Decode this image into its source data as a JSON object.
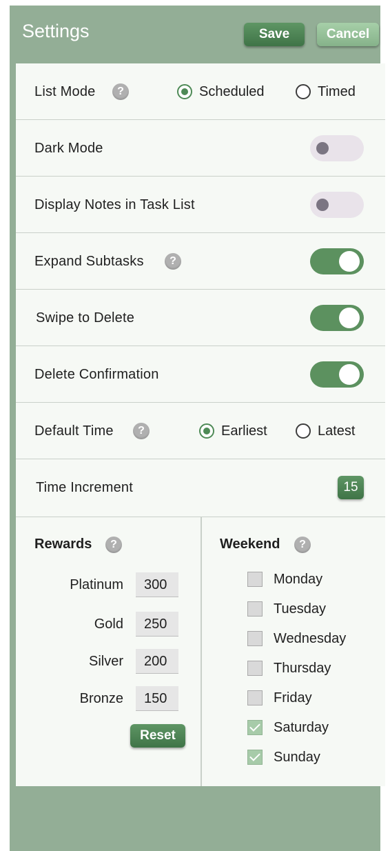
{
  "header": {
    "title": "Settings",
    "save_label": "Save",
    "cancel_label": "Cancel"
  },
  "list_mode": {
    "label": "List Mode",
    "options": [
      "Scheduled",
      "Timed"
    ],
    "selected": "Scheduled"
  },
  "dark_mode": {
    "label": "Dark Mode",
    "on": false
  },
  "display_notes": {
    "label": "Display Notes in Task List",
    "on": false
  },
  "expand_subtasks": {
    "label": "Expand Subtasks",
    "on": true
  },
  "swipe_delete": {
    "label": "Swipe to Delete",
    "on": true
  },
  "delete_confirmation": {
    "label": "Delete Confirmation",
    "on": true
  },
  "default_time": {
    "label": "Default Time",
    "options": [
      "Earliest",
      "Latest"
    ],
    "selected": "Earliest"
  },
  "time_increment": {
    "label": "Time Increment",
    "value": "15"
  },
  "rewards": {
    "title": "Rewards",
    "items": [
      {
        "label": "Platinum",
        "value": "300"
      },
      {
        "label": "Gold",
        "value": "250"
      },
      {
        "label": "Silver",
        "value": "200"
      },
      {
        "label": "Bronze",
        "value": "150"
      }
    ],
    "reset_label": "Reset"
  },
  "weekend": {
    "title": "Weekend",
    "days": [
      {
        "label": "Monday",
        "checked": false
      },
      {
        "label": "Tuesday",
        "checked": false
      },
      {
        "label": "Wednesday",
        "checked": false
      },
      {
        "label": "Thursday",
        "checked": false
      },
      {
        "label": "Friday",
        "checked": false
      },
      {
        "label": "Saturday",
        "checked": true
      },
      {
        "label": "Sunday",
        "checked": true
      }
    ]
  },
  "help_glyph": "?",
  "colors": {
    "accent": "#4e8a56",
    "header_bg": "#93ae96",
    "panel_bg": "#f6f9f5",
    "toggle_on": "#5c915f",
    "toggle_off": "#e9e3ea"
  }
}
